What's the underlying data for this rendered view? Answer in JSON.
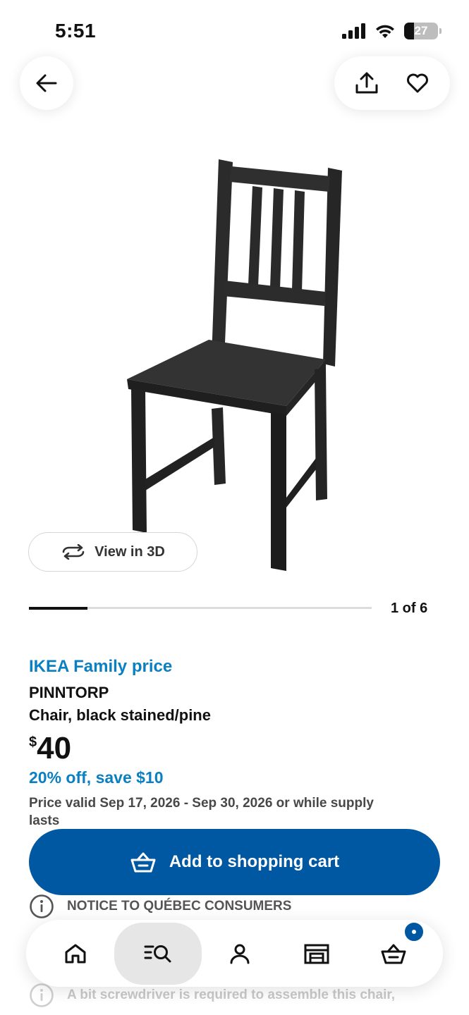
{
  "status": {
    "time": "5:51",
    "battery": "27"
  },
  "carousel": {
    "counter": "1 of 6",
    "progress": 0.17
  },
  "view3d": {
    "label": "View in 3D"
  },
  "product": {
    "family_label": "IKEA Family price",
    "name": "PINNTORP",
    "description": "Chair, black stained/pine",
    "currency": "$",
    "price": "40",
    "discount": "20% off, save $10",
    "validity": "Price valid Sep 17, 2026 - Sep 30, 2026 or while supply lasts"
  },
  "cart_button": {
    "label": "Add to shopping cart"
  },
  "notices": {
    "quebec": "NOTICE TO QUÉBEC CONSUMERS",
    "assembly": "A bit screwdriver is required to assemble this chair,"
  },
  "nav": {
    "items": [
      "home-icon",
      "search-list-icon",
      "profile-icon",
      "store-icon",
      "cart-icon"
    ],
    "active": "search-list-icon"
  },
  "colors": {
    "accent": "#0058a3",
    "family_blue": "#0a7fc2"
  }
}
